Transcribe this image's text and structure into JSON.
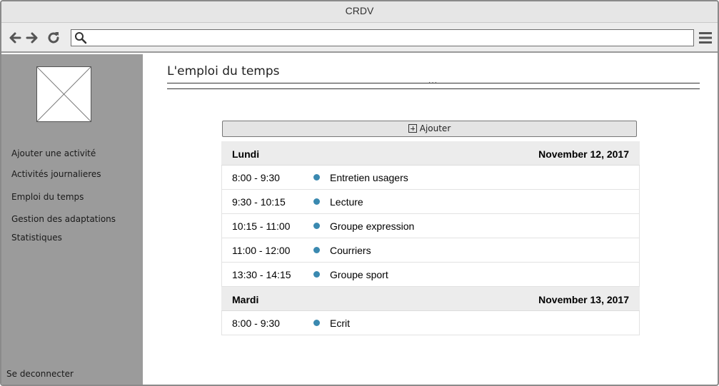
{
  "window": {
    "title": "CRDV"
  },
  "toolbar": {
    "url_value": ""
  },
  "sidebar": {
    "items": [
      {
        "label": "Ajouter une activité"
      },
      {
        "label": "Activités journalieres"
      },
      {
        "label": "Emploi du temps"
      },
      {
        "label": "Gestion des adaptations"
      },
      {
        "label": "Statistiques"
      }
    ],
    "logout_label": "Se deconnecter"
  },
  "main": {
    "title": "L'emploi du temps",
    "add_label": "Ajouter"
  },
  "colors": {
    "dot": "#3a89b0",
    "sidebar": "#9b9b9b",
    "header": "#ececec"
  },
  "schedule": [
    {
      "day": "Lundi",
      "date": "November 12, 2017",
      "entries": [
        {
          "time": "8:00 - 9:30",
          "activity": "Entretien usagers"
        },
        {
          "time": "9:30 - 10:15",
          "activity": "Lecture"
        },
        {
          "time": "10:15 - 11:00",
          "activity": "Groupe expression"
        },
        {
          "time": "11:00 - 12:00",
          "activity": "Courriers"
        },
        {
          "time": "13:30 - 14:15",
          "activity": "Groupe sport"
        }
      ]
    },
    {
      "day": "Mardi",
      "date": "November 13, 2017",
      "entries": [
        {
          "time": "8:00 - 9:30",
          "activity": "Ecrit"
        }
      ]
    }
  ]
}
